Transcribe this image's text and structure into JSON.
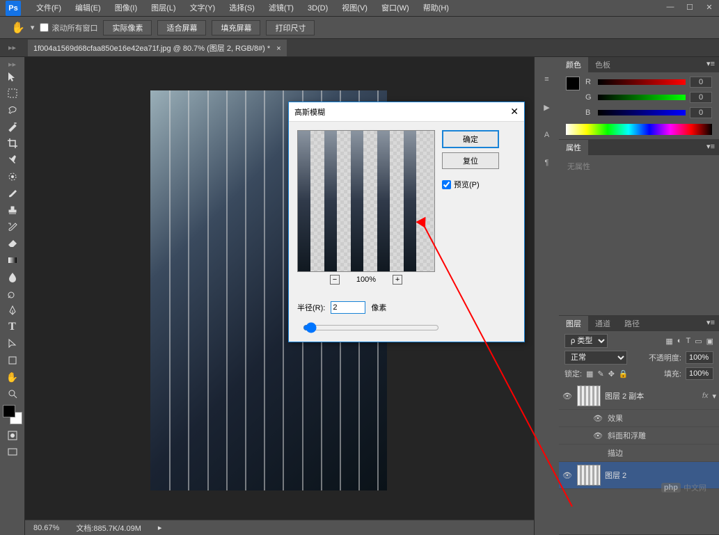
{
  "app": {
    "logo": "Ps"
  },
  "menu": [
    "文件(F)",
    "编辑(E)",
    "图像(I)",
    "图层(L)",
    "文字(Y)",
    "选择(S)",
    "滤镜(T)",
    "3D(D)",
    "视图(V)",
    "窗口(W)",
    "帮助(H)"
  ],
  "options": {
    "scroll_all": "滚动所有窗口",
    "actual": "实际像素",
    "fit": "适合屏幕",
    "fill": "填充屏幕",
    "print": "打印尺寸"
  },
  "document_tab": "1f004a1569d68cfaa850e16e42ea71f.jpg @ 80.7% (图层 2, RGB/8#) *",
  "dialog": {
    "title": "高斯模糊",
    "ok": "确定",
    "reset": "复位",
    "preview": "预览(P)",
    "zoom": "100%",
    "radius_label": "半径(R):",
    "radius_value": "2",
    "radius_unit": "像素"
  },
  "color_panel": {
    "tabs": [
      "颜色",
      "色板"
    ],
    "r": "R",
    "g": "G",
    "b": "B",
    "rv": "0",
    "gv": "0",
    "bv": "0"
  },
  "properties_panel": {
    "tab": "属性",
    "empty": "无属性"
  },
  "layers_panel": {
    "tabs": [
      "图层",
      "通道",
      "路径"
    ],
    "kind_label": "ρ 类型",
    "blend": "正常",
    "opacity_label": "不透明度:",
    "opacity_val": "100%",
    "lock_label": "锁定:",
    "fill_label": "填充:",
    "fill_val": "100%",
    "layers": [
      {
        "name": "图层 2 副本",
        "fx": true,
        "fx_label": "fx",
        "effects_label": "效果",
        "bevel": "斜面和浮雕",
        "stroke": "描边"
      },
      {
        "name": "图层 2"
      }
    ]
  },
  "status": {
    "zoom": "80.67%",
    "doc_label": "文档:",
    "doc_size": "885.7K/4.09M"
  },
  "watermark": {
    "brand": "php",
    "text": "中文网"
  }
}
